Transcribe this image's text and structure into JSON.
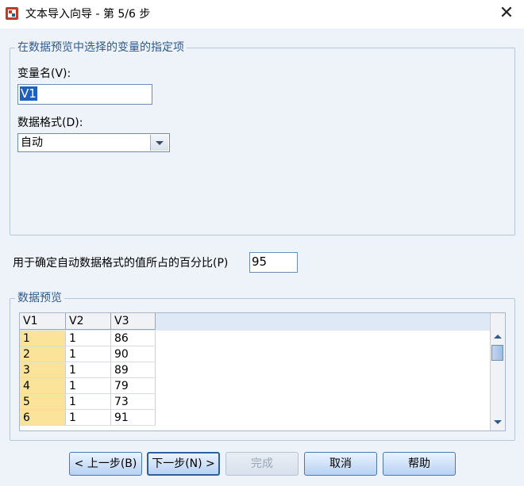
{
  "window": {
    "title": "文本导入向导 - 第 5/6 步",
    "close_glyph": "✕"
  },
  "variables_group": {
    "legend": "在数据预览中选择的变量的指定项",
    "name_label": "变量名(V):",
    "name_value": "V1",
    "format_label": "数据格式(D):",
    "format_value": "自动"
  },
  "percent": {
    "label": "用于确定自动数据格式的值所占的百分比(P)",
    "value": "95"
  },
  "preview_group": {
    "legend": "数据预览",
    "columns": [
      "V1",
      "V2",
      "V3"
    ],
    "rows": [
      [
        "1",
        "1",
        "86"
      ],
      [
        "2",
        "1",
        "90"
      ],
      [
        "3",
        "1",
        "89"
      ],
      [
        "4",
        "1",
        "79"
      ],
      [
        "5",
        "1",
        "73"
      ],
      [
        "6",
        "1",
        "91"
      ]
    ]
  },
  "buttons": {
    "back": "< 上一步(B)",
    "next": "下一步(N) >",
    "finish": "完成",
    "cancel": "取消",
    "help": "帮助"
  }
}
